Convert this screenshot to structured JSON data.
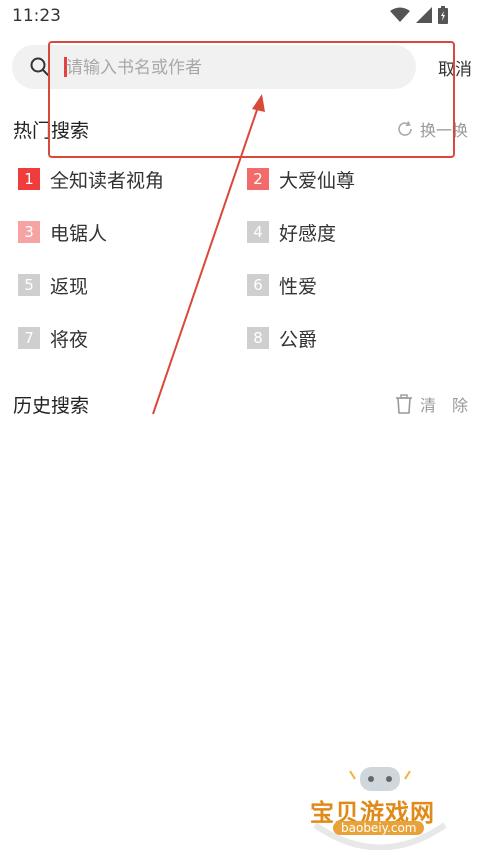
{
  "status": {
    "time": "11:23"
  },
  "search": {
    "placeholder": "请输入书名或作者",
    "cancel_label": "取消"
  },
  "hot": {
    "title": "热门搜索",
    "refresh_label": "换一换",
    "items": [
      {
        "rank": "1",
        "label": "全知读者视角",
        "color": "#f03c3c"
      },
      {
        "rank": "2",
        "label": "大爱仙尊",
        "color": "#f36a6a"
      },
      {
        "rank": "3",
        "label": "电锯人",
        "color": "#f5a3a3"
      },
      {
        "rank": "4",
        "label": "好感度",
        "color": "#cfcfcf"
      },
      {
        "rank": "5",
        "label": "返现",
        "color": "#cfcfcf"
      },
      {
        "rank": "6",
        "label": "性爱",
        "color": "#cfcfcf"
      },
      {
        "rank": "7",
        "label": "将夜",
        "color": "#cfcfcf"
      },
      {
        "rank": "8",
        "label": "公爵",
        "color": "#cfcfcf"
      }
    ]
  },
  "history": {
    "title": "历史搜索",
    "clear_label": "清　除"
  },
  "watermark": {
    "text": "宝贝游戏网",
    "url": "baobeiy.com"
  }
}
